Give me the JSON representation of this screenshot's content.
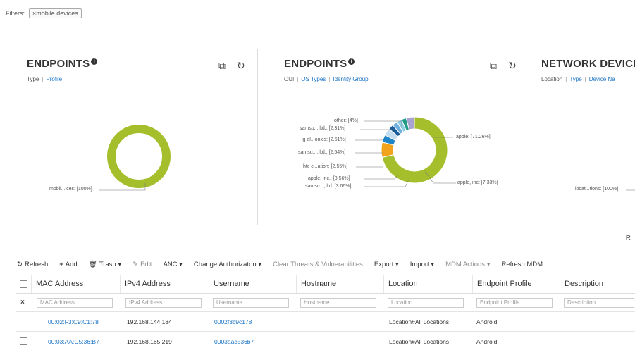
{
  "filters": {
    "label": "Filters:",
    "chip": "×mobile devices"
  },
  "panels": [
    {
      "title": "ENDPOINTS",
      "tabs": [
        "Type",
        "Profile"
      ],
      "active_tab": 0,
      "chart_data": {
        "type": "pie",
        "donut": true,
        "slices": [
          {
            "label": "mobil...ices",
            "value": 100,
            "color": "#a4bf2b"
          }
        ],
        "labels": [
          "mobil...ices: [100%]"
        ]
      }
    },
    {
      "title": "ENDPOINTS",
      "tabs": [
        "OUI",
        "OS Types",
        "Identity Group"
      ],
      "active_tab": 0,
      "chart_data": {
        "type": "pie",
        "donut": true,
        "slices": [
          {
            "label": "apple",
            "value": 71.26,
            "color": "#a4bf2b"
          },
          {
            "label": "apple, inc",
            "value": 7.33,
            "color": "#f2a21b"
          },
          {
            "label": "samsu..., ltd",
            "value": 3.66,
            "color": "#1f85c9"
          },
          {
            "label": "apple, inc.",
            "value": 3.56,
            "color": "#c4dcef"
          },
          {
            "label": "htc c...ation",
            "value": 2.55,
            "color": "#1a5c9a"
          },
          {
            "label": "samsu..., ltd.",
            "value": 2.54,
            "color": "#6fb0de"
          },
          {
            "label": "lg el...onics",
            "value": 2.51,
            "color": "#8fd0e8"
          },
          {
            "label": "samsu... ltd.",
            "value": 2.31,
            "color": "#1e9c86"
          },
          {
            "label": "other",
            "value": 4.0,
            "color": "#a9a3d2"
          }
        ],
        "labels": {
          "apple": "apple: [71.26%]",
          "apple_inc": "apple, inc: [7.33%]",
          "other": "other: [4%]",
          "samsu1": "samsu... ltd.: [2.31%]",
          "lg": "lg el...onics: [2.51%]",
          "samsu2": "samsu..., ltd.: [2.54%]",
          "htc": "htc c...ation: [2.55%]",
          "apple_inc2": "apple, inc.: [3.56%]",
          "samsu3": "samsu..., ltd: [3.66%]"
        }
      }
    },
    {
      "title": "NETWORK DEVICE",
      "tabs": [
        "Location",
        "Type",
        "Device Na"
      ],
      "active_tab": 0,
      "chart_data": {
        "type": "pie",
        "donut": true,
        "slices": [
          {
            "label": "locat...tions",
            "value": 100,
            "color": "#a4bf2b"
          }
        ],
        "labels": [
          "locat...tions: [100%]"
        ]
      }
    }
  ],
  "r_text": "R",
  "toolbar": {
    "refresh": "Refresh",
    "add": "Add",
    "trash": "Trash ▾",
    "edit": "Edit",
    "anc": "ANC ▾",
    "change_auth": "Change Authorizaton ▾",
    "clear_threats": "Clear Threats & Vulnerabilities",
    "export": "Export ▾",
    "import": "Import ▾",
    "mdm_actions": "MDM Actions ▾",
    "refresh_mdm": "Refresh MDM"
  },
  "table": {
    "columns": [
      "MAC Address",
      "IPv4 Address",
      "Username",
      "Hostname",
      "Location",
      "Endpoint Profile",
      "Description"
    ],
    "filter_placeholders": [
      "MAC Address",
      "IPv4 Address",
      "Username",
      "Hostname",
      "Location",
      "Endpoint Profile",
      "Description"
    ],
    "rows": [
      {
        "mac": "00:02:F3:C9:C1:78",
        "ip": "192.168.144.184",
        "user": "0002f3c9c178",
        "host": "",
        "location": "Location#All Locations",
        "profile": "Android",
        "desc": ""
      },
      {
        "mac": "00:03:AA:C5:36:B7",
        "ip": "192.168.165.219",
        "user": "0003aac536b7",
        "host": "",
        "location": "Location#All Locations",
        "profile": "Android",
        "desc": ""
      }
    ]
  }
}
